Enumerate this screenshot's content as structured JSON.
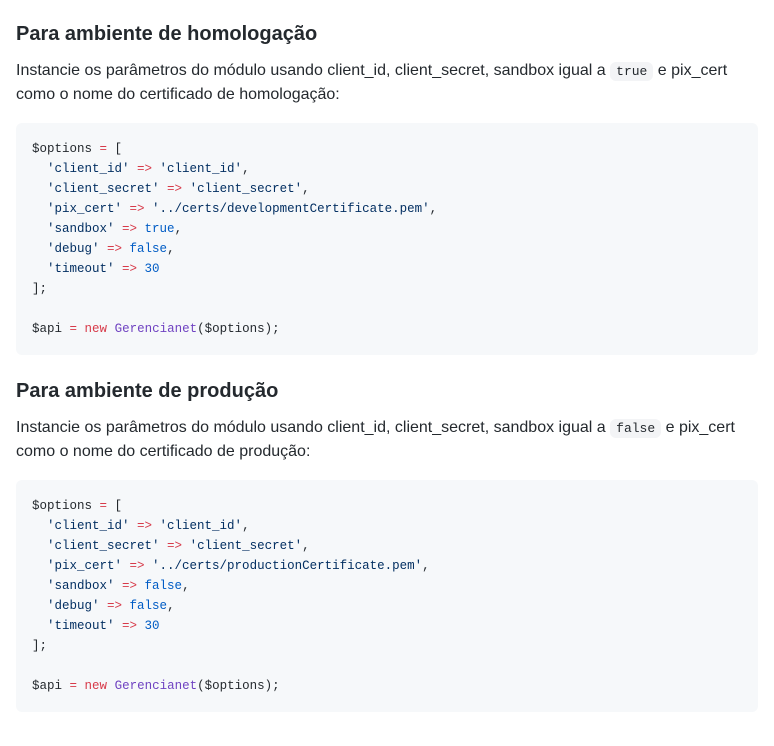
{
  "section1": {
    "heading": "Para ambiente de homologação",
    "para_before": "Instancie os parâmetros do módulo usando client_id, client_secret, sandbox igual a ",
    "para_code": "true",
    "para_after": " e pix_cert como o nome do certificado de homologação:",
    "code": {
      "l1_a": "$options ",
      "l1_b": "=",
      "l1_c": " [",
      "l2_a": "  ",
      "l2_b": "'client_id'",
      "l2_c": " => ",
      "l2_d": "'client_id'",
      "l2_e": ",",
      "l3_a": "  ",
      "l3_b": "'client_secret'",
      "l3_c": " => ",
      "l3_d": "'client_secret'",
      "l3_e": ",",
      "l4_a": "  ",
      "l4_b": "'pix_cert'",
      "l4_c": " => ",
      "l4_d": "'../certs/developmentCertificate.pem'",
      "l4_e": ",",
      "l5_a": "  ",
      "l5_b": "'sandbox'",
      "l5_c": " => ",
      "l5_d": "true",
      "l5_e": ",",
      "l6_a": "  ",
      "l6_b": "'debug'",
      "l6_c": " => ",
      "l6_d": "false",
      "l6_e": ",",
      "l7_a": "  ",
      "l7_b": "'timeout'",
      "l7_c": " => ",
      "l7_d": "30",
      "l8": "];",
      "l9_a": "$api ",
      "l9_b": "=",
      "l9_c": " ",
      "l9_d": "new",
      "l9_e": " ",
      "l9_f": "Gerencianet",
      "l9_g": "($options);"
    }
  },
  "section2": {
    "heading": "Para ambiente de produção",
    "para_before": "Instancie os parâmetros do módulo usando client_id, client_secret, sandbox igual a ",
    "para_code": "false",
    "para_after": " e pix_cert como o nome do certificado de produção:",
    "code": {
      "l1_a": "$options ",
      "l1_b": "=",
      "l1_c": " [",
      "l2_a": "  ",
      "l2_b": "'client_id'",
      "l2_c": " => ",
      "l2_d": "'client_id'",
      "l2_e": ",",
      "l3_a": "  ",
      "l3_b": "'client_secret'",
      "l3_c": " => ",
      "l3_d": "'client_secret'",
      "l3_e": ",",
      "l4_a": "  ",
      "l4_b": "'pix_cert'",
      "l4_c": " => ",
      "l4_d": "'../certs/productionCertificate.pem'",
      "l4_e": ",",
      "l5_a": "  ",
      "l5_b": "'sandbox'",
      "l5_c": " => ",
      "l5_d": "false",
      "l5_e": ",",
      "l6_a": "  ",
      "l6_b": "'debug'",
      "l6_c": " => ",
      "l6_d": "false",
      "l6_e": ",",
      "l7_a": "  ",
      "l7_b": "'timeout'",
      "l7_c": " => ",
      "l7_d": "30",
      "l8": "];",
      "l9_a": "$api ",
      "l9_b": "=",
      "l9_c": " ",
      "l9_d": "new",
      "l9_e": " ",
      "l9_f": "Gerencianet",
      "l9_g": "($options);"
    }
  }
}
